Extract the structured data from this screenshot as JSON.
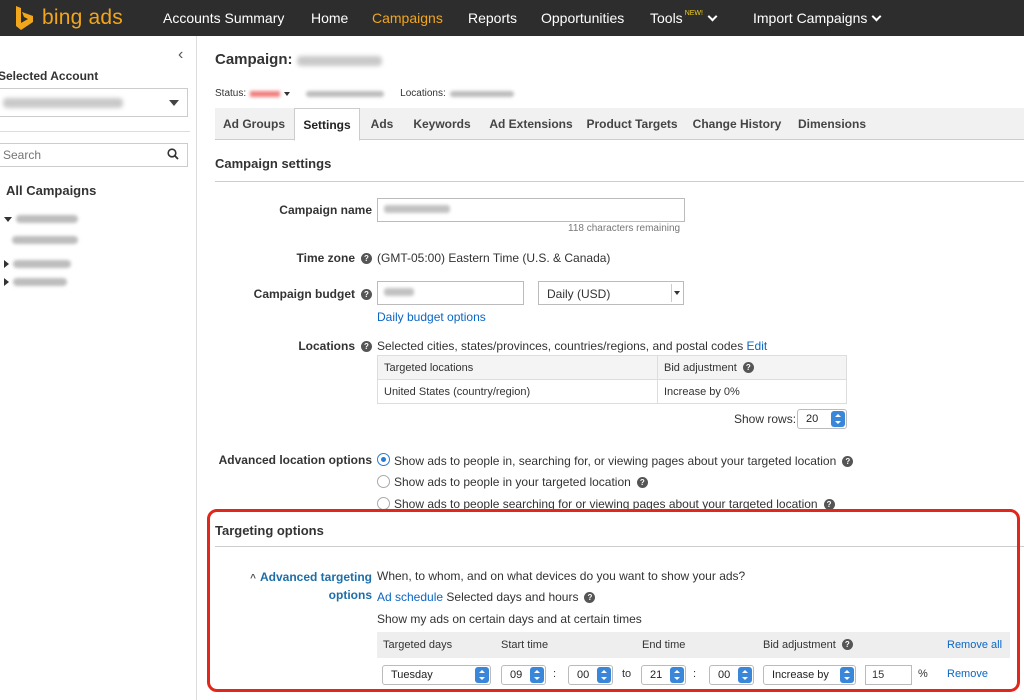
{
  "brand": {
    "name": "bing ads"
  },
  "nav": {
    "items": [
      {
        "label": "Accounts Summary"
      },
      {
        "label": "Home"
      },
      {
        "label": "Campaigns"
      },
      {
        "label": "Reports"
      },
      {
        "label": "Opportunities"
      },
      {
        "label": "Tools"
      },
      {
        "label": "Import Campaigns"
      }
    ],
    "tools_badge": "NEW!"
  },
  "sidebar": {
    "selected_account_label": "Selected Account",
    "search_placeholder": "Search",
    "all_campaigns": "All Campaigns"
  },
  "header": {
    "campaign_prefix": "Campaign:",
    "status_label": "Status:",
    "locations_label": "Locations:"
  },
  "tabs": [
    "Ad Groups",
    "Settings",
    "Ads",
    "Keywords",
    "Ad Extensions",
    "Product Targets",
    "Change History",
    "Dimensions"
  ],
  "campaign_settings": {
    "heading": "Campaign settings",
    "name_label": "Campaign name",
    "chars_remaining": "118 characters remaining",
    "timezone_label": "Time zone",
    "timezone_value": "(GMT-05:00) Eastern Time (U.S. & Canada)",
    "budget_label": "Campaign budget",
    "budget_type": "Daily (USD)",
    "budget_options_link": "Daily budget options",
    "locations_label": "Locations",
    "locations_desc": "Selected cities, states/provinces, countries/regions, and postal codes",
    "locations_edit": "Edit",
    "loc_table": {
      "col1": "Targeted locations",
      "col2": "Bid adjustment",
      "row_loc": "United States (country/region)",
      "row_bid": "Increase by 0%"
    },
    "show_rows_label": "Show rows:",
    "show_rows_value": "20",
    "adv_location_label": "Advanced location options",
    "adv_location_options": [
      "Show ads to people in, searching for, or viewing pages about your targeted location",
      "Show ads to people in your targeted location",
      "Show ads to people searching for or viewing pages about your targeted location"
    ]
  },
  "targeting": {
    "heading": "Targeting options",
    "adv_label_1": "Advanced targeting",
    "adv_label_2": "options",
    "question": "When, to whom, and on what devices do you want to show your ads?",
    "ad_schedule_link": "Ad schedule",
    "ad_schedule_value": "Selected days and hours",
    "schedule_desc": "Show my ads on certain days and at certain times",
    "table_headers": {
      "days": "Targeted days",
      "start": "Start time",
      "end": "End time",
      "bid": "Bid adjustment",
      "remove_all": "Remove all"
    },
    "row": {
      "day": "Tuesday",
      "start_hour": "09",
      "start_min": "00",
      "to": "to",
      "end_hour": "21",
      "end_min": "00",
      "bid_type": "Increase by",
      "bid_value": "15",
      "pct": "%",
      "remove": "Remove"
    }
  },
  "colors": {
    "accent": "#f2a61b",
    "link": "#0b66c4",
    "highlight": "#e1261c",
    "nav_bg": "#2d2d2d"
  }
}
